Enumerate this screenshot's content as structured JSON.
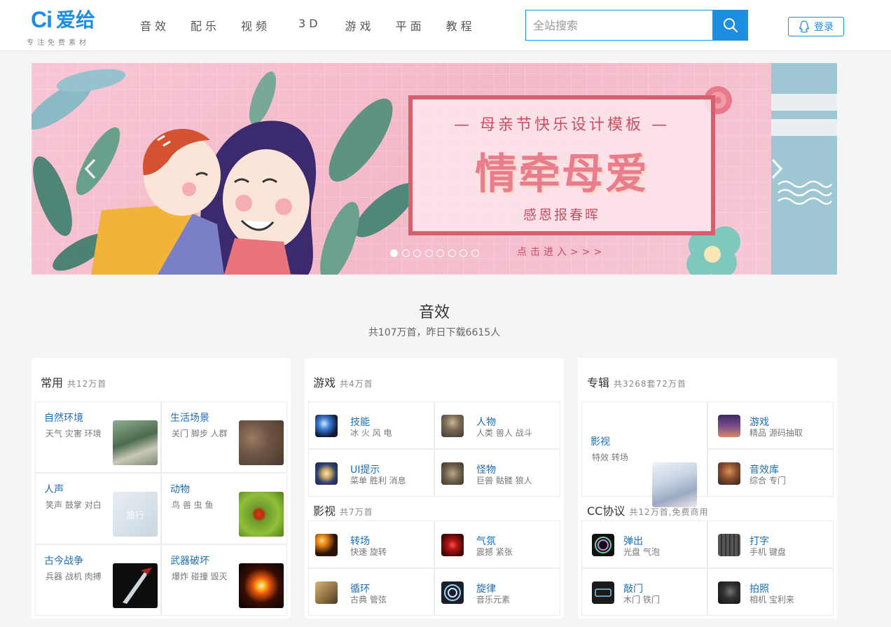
{
  "logo": {
    "mark": "Ci",
    "name": "爱给",
    "tagline": "专注免费素材"
  },
  "nav": {
    "items": [
      "音效",
      "配乐",
      "视频",
      "3D",
      "游戏",
      "平面",
      "教程"
    ]
  },
  "search": {
    "placeholder": "全站搜索"
  },
  "login": {
    "label": "登录"
  },
  "banner": {
    "top_line": "— 母亲节快乐设计模板 —",
    "main_title": "情牵母爱",
    "subtitle": "感恩报春晖",
    "enter": "点击进入>>>",
    "slide_count": 8,
    "active_slide": 1
  },
  "section": {
    "title": "音效",
    "subtitle": "共107万首，昨日下载6615人"
  },
  "cards": {
    "common": {
      "title": "常用",
      "count": "共12万首",
      "items": [
        {
          "name": "自然环境",
          "tags": "天气 灾害 环境"
        },
        {
          "name": "生活场景",
          "tags": "关门 脚步 人群"
        },
        {
          "name": "人声",
          "tags": "笑声 鼓掌 对白"
        },
        {
          "name": "动物",
          "tags": "鸟 兽 虫 鱼"
        },
        {
          "name": "古今战争",
          "tags": "兵器 战机 肉搏"
        },
        {
          "name": "武器破坏",
          "tags": "爆炸 碰撞 毁灭"
        }
      ]
    },
    "game": {
      "title": "游戏",
      "count": "共4万首",
      "items": [
        {
          "name": "技能",
          "tags": "冰 火 风 电"
        },
        {
          "name": "人物",
          "tags": "人类 兽人 战斗"
        },
        {
          "name": "UI提示",
          "tags": "菜单 胜利 消息"
        },
        {
          "name": "怪物",
          "tags": "巨兽 骷髅 狼人"
        }
      ]
    },
    "film": {
      "title": "影视",
      "count": "共7万首",
      "items": [
        {
          "name": "转场",
          "tags": "快速 旋转"
        },
        {
          "name": "气氛",
          "tags": "震撼 紧张"
        },
        {
          "name": "循环",
          "tags": "古典 管弦"
        },
        {
          "name": "旋律",
          "tags": "音乐元素"
        }
      ]
    },
    "album": {
      "title": "专辑",
      "count": "共3268套72万首",
      "items": [
        {
          "name": "影视",
          "tags": "特效 转场"
        },
        {
          "name": "游戏",
          "tags": "精品 源码抽取"
        },
        {
          "name": "音效库",
          "tags": "综合 专门"
        }
      ]
    },
    "cc": {
      "title": "CC协议",
      "count": "共12万首,免费商用",
      "items": [
        {
          "name": "弹出",
          "tags": "光盘 气泡"
        },
        {
          "name": "打字",
          "tags": "手机 键盘"
        },
        {
          "name": "敲门",
          "tags": "木门 铁门"
        },
        {
          "name": "拍照",
          "tags": "相机 宝利来"
        }
      ]
    }
  },
  "thumb_overlay": "旅行",
  "colors": {
    "brand": "#1e8ee0",
    "link": "#1a6fb8",
    "banner_accent": "#c65062"
  }
}
